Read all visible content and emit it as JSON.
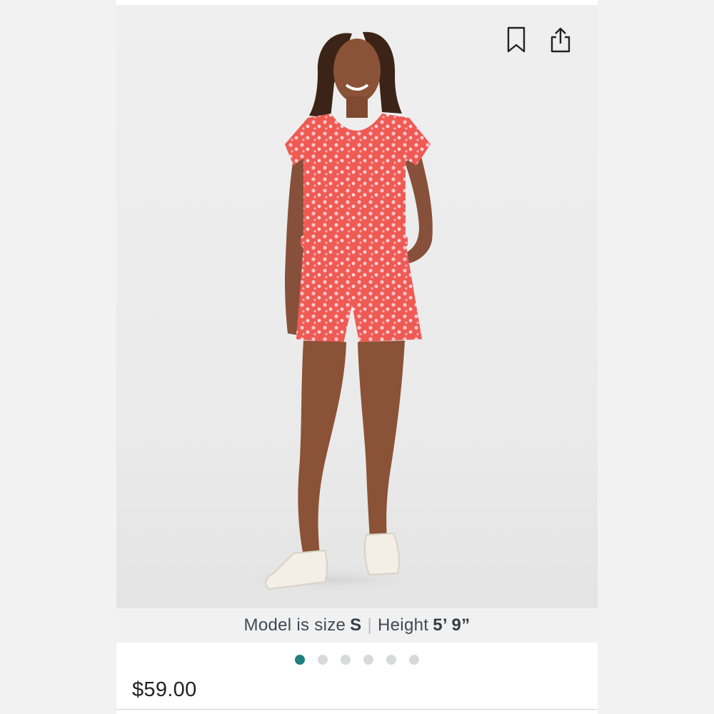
{
  "product": {
    "image_alt": "Model wearing coral floral short-sleeve romper with white sneakers",
    "price": "$59.00"
  },
  "model_info": {
    "label_size": "Model is size",
    "size_value": "S",
    "separator": "|",
    "label_height": "Height",
    "height_value": "5’ 9”"
  },
  "carousel": {
    "total_slides": 6,
    "active_index": 0
  },
  "icons": {
    "bookmark": "bookmark-icon",
    "share": "share-icon"
  },
  "colors": {
    "accent_dot": "#1f7f7c",
    "inactive_dot": "#d7d9db",
    "romper": "#f0574f"
  }
}
